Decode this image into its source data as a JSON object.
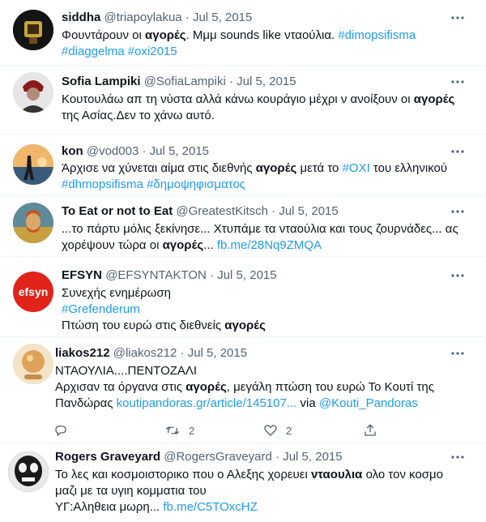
{
  "tweets": [
    {
      "name": "siddha",
      "handle": "@triapoylakua",
      "dot": "·",
      "date": "Jul 5, 2015",
      "l1": {
        "a": "Φουντάρουν οι ",
        "b": "αγορές",
        "c": ". Μμμ sounds like νταούλια. ",
        "tag": "#dimopsifisma"
      },
      "l2": {
        "t1": "#diaggelma",
        "t2": "#oxi2015"
      }
    },
    {
      "name": "Sofia Lampiki",
      "handle": "@SofiaLampiki",
      "dot": "·",
      "date": "Jul 5, 2015",
      "l1": {
        "a": "Κουτουλάω απ τη νύστα αλλά κάνω κουράγιο μέχρι ν ανοίξουν οι ",
        "b": "αγορές"
      },
      "l2": "της Ασίας.Δεν το χάνω αυτό."
    },
    {
      "name": "kon",
      "handle": "@vod003",
      "dot": "·",
      "date": "Jul 5, 2015",
      "l1": {
        "a": "Άρχισε να χύνεται αίμα στις διεθνής ",
        "b": "αγορές",
        "c": " μετά το ",
        "tag": "#ΟΧΙ",
        "d": " του ελληνικού"
      },
      "l2": {
        "t1": "#dhmopsifisma",
        "t2": "#δημοψηφισματος"
      }
    },
    {
      "name": "To Eat or not to Eat",
      "handle": "@GreatestKitsch",
      "dot": "·",
      "date": "Jul 5, 2015",
      "l1": "...το πάρτυ μόλις ξεκίνησε... Χτυπάμε τα νταούλια και τους ζουρνάδες... ας",
      "l2": {
        "a": "χορέψουν τώρα οι ",
        "b": "αγορές",
        "c": "... ",
        "link": "fb.me/28Nq9ZMQA"
      }
    },
    {
      "name": "EFSYN",
      "handle": "@EFSYNTAKTON",
      "dot": "·",
      "date": "Jul 5, 2015",
      "avatar_text": "efsyn",
      "l1": "Συνεχής ενημέρωση",
      "l2": "#Grefenderum",
      "l3": {
        "a": "Πτώση του ευρώ στις διεθνείς ",
        "b": "αγορές"
      }
    },
    {
      "name": "liakos212",
      "handle": "@liakos212",
      "dot": "·",
      "date": "Jul 5, 2015",
      "l1": "ΝΤΑΟΥΛΙΑ....ΠΕΝΤΟΖΑΛΙ",
      "l2": {
        "a": "Αρχισαν τα όργανα στις ",
        "b": "αγορές",
        "c": ", μεγάλη πτώση του ευρώ Το Κουτί της"
      },
      "l3": {
        "a": "Πανδώρας ",
        "link": "koutipandoras.gr/article/145107...",
        "c": " via ",
        "mention": "@Kouti_Pandoras"
      },
      "retweets": "2",
      "likes": "2"
    },
    {
      "name": "Rogers Graveyard",
      "handle": "@RogersGraveyard",
      "dot": "·",
      "date": "Jul 5, 2015",
      "l1": {
        "a": "Το λες και κοσμοιστορικο που ο Αλεξης χορευει ",
        "b": "νταουλια",
        "c": " ολο τον κοσμο"
      },
      "l2": "μαζι με τα υγιη κομματια του",
      "l3": {
        "a": "ΥΓ:Αληθεια μωρη... ",
        "link": "fb.me/C5TOxcHZ"
      }
    }
  ],
  "icons": [
    "more-icon",
    "reply-icon",
    "retweet-icon",
    "like-icon",
    "share-icon"
  ],
  "colors": {
    "link": "#1d9bf0",
    "meta": "#536471",
    "text": "#0f1419",
    "divider": "#eff3f4"
  }
}
